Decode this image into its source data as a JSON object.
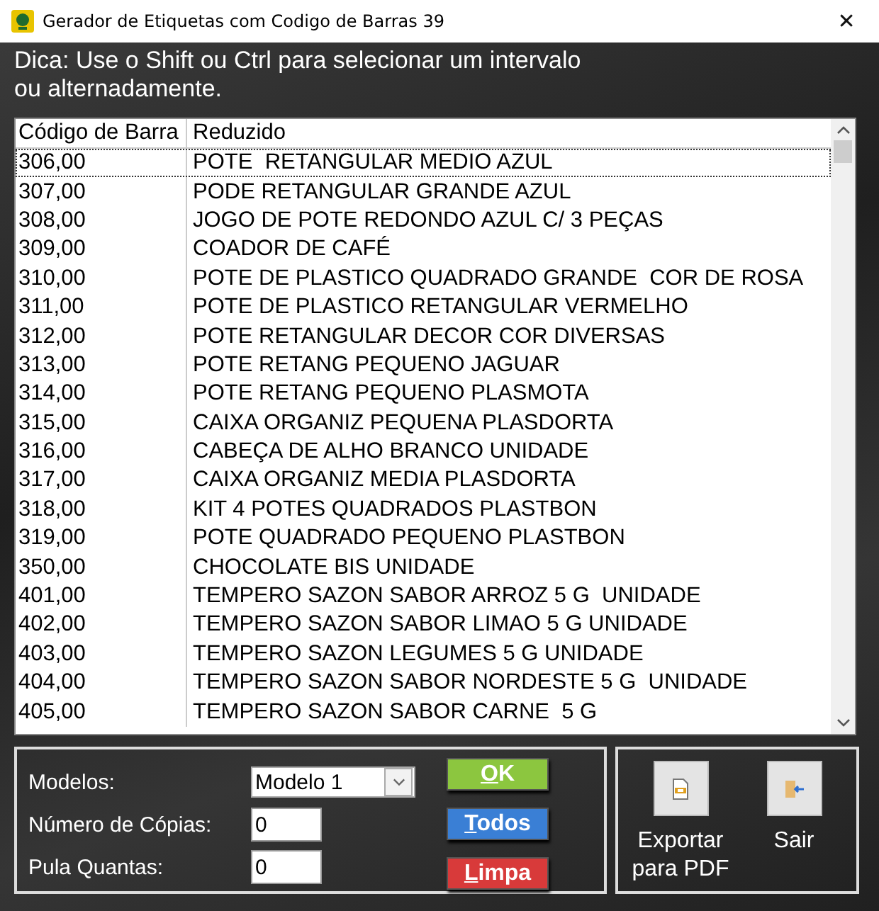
{
  "window": {
    "title": "Gerador de Etiquetas com Codigo de Barras 39",
    "close": "✕"
  },
  "hint": "Dica: Use o Shift ou Ctrl para selecionar um intervalo ou alternadamente.",
  "table": {
    "columns": [
      "Código de Barra",
      "Reduzido"
    ],
    "rows": [
      {
        "code": "306,00",
        "name": "POTE  RETANGULAR MEDIO AZUL",
        "focused": true
      },
      {
        "code": "307,00",
        "name": "PODE RETANGULAR GRANDE AZUL",
        "focused": false
      },
      {
        "code": "308,00",
        "name": "JOGO DE POTE REDONDO AZUL C/ 3 PEÇAS",
        "focused": false
      },
      {
        "code": "309,00",
        "name": "COADOR DE CAFÉ",
        "focused": false
      },
      {
        "code": "310,00",
        "name": "POTE DE PLASTICO QUADRADO GRANDE  COR DE ROSA",
        "focused": false
      },
      {
        "code": "311,00",
        "name": "POTE DE PLASTICO RETANGULAR VERMELHO",
        "focused": false
      },
      {
        "code": "312,00",
        "name": "POTE RETANGULAR DECOR COR DIVERSAS",
        "focused": false
      },
      {
        "code": "313,00",
        "name": "POTE RETANG PEQUENO JAGUAR",
        "focused": false
      },
      {
        "code": "314,00",
        "name": "POTE RETANG PEQUENO PLASMOTA",
        "focused": false
      },
      {
        "code": "315,00",
        "name": "CAIXA ORGANIZ PEQUENA PLASDORTA",
        "focused": false
      },
      {
        "code": "316,00",
        "name": "CABEÇA DE ALHO BRANCO UNIDADE",
        "focused": false
      },
      {
        "code": "317,00",
        "name": "CAIXA ORGANIZ MEDIA PLASDORTA",
        "focused": false
      },
      {
        "code": "318,00",
        "name": "KIT 4 POTES QUADRADOS PLASTBON",
        "focused": false
      },
      {
        "code": "319,00",
        "name": "POTE QUADRADO PEQUENO PLASTBON",
        "focused": false
      },
      {
        "code": "350,00",
        "name": "CHOCOLATE BIS UNIDADE",
        "focused": false
      },
      {
        "code": "401,00",
        "name": "TEMPERO SAZON SABOR ARROZ 5 G  UNIDADE",
        "focused": false
      },
      {
        "code": "402,00",
        "name": "TEMPERO SAZON SABOR LIMAO 5 G UNIDADE",
        "focused": false
      },
      {
        "code": "403,00",
        "name": "TEMPERO SAZON LEGUMES 5 G UNIDADE",
        "focused": false
      },
      {
        "code": "404,00",
        "name": "TEMPERO SAZON SABOR NORDESTE 5 G  UNIDADE",
        "focused": false
      },
      {
        "code": "405,00",
        "name": "TEMPERO SAZON SABOR CARNE  5 G",
        "focused": false
      }
    ]
  },
  "form": {
    "fields": [
      {
        "label": "Modelos:",
        "kind": "select",
        "value": "Modelo 1"
      },
      {
        "label": "Número de Cópias:",
        "kind": "input",
        "value": "0"
      },
      {
        "label": "Pula Quantas:",
        "kind": "input",
        "value": "0"
      }
    ],
    "buttons": [
      {
        "key": "O",
        "rest": "K",
        "color": "#8cc63f"
      },
      {
        "key": "T",
        "rest": "odos",
        "color": "#3a7fd5"
      },
      {
        "key": "L",
        "rest": "impa",
        "color": "#d83a3a"
      }
    ]
  },
  "actions": [
    {
      "label": "Exportar para PDF",
      "kind": "pdf"
    },
    {
      "label": "Sair",
      "kind": "exit"
    }
  ]
}
